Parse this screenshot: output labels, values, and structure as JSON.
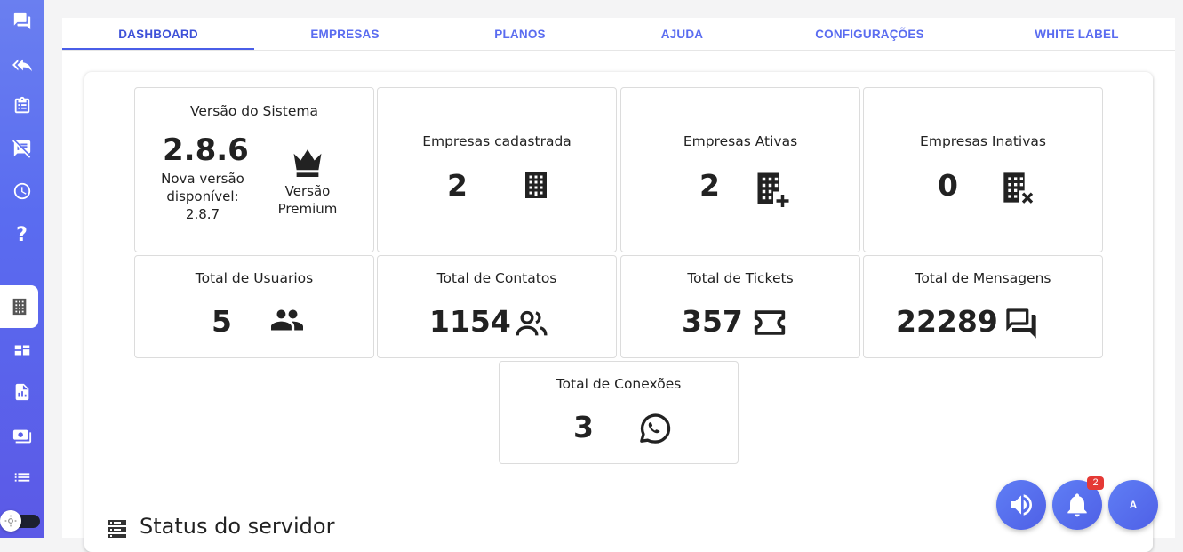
{
  "tabs": [
    {
      "label": "DASHBOARD",
      "active": true
    },
    {
      "label": "EMPRESAS"
    },
    {
      "label": "PLANOS"
    },
    {
      "label": "AJUDA"
    },
    {
      "label": "CONFIGURAÇÕES"
    },
    {
      "label": "WHITE LABEL"
    }
  ],
  "sidebar": {
    "items": [
      "chat-icon",
      "reply-all-icon",
      "clipboard-icon",
      "speaker-notes-off-icon",
      "clock-icon",
      "help-icon",
      "business-icon",
      "dashboard-icon",
      "report-icon",
      "payments-icon",
      "list-icon"
    ],
    "help_label": "?"
  },
  "cards": {
    "version": {
      "title": "Versão do Sistema",
      "value": "2.8.6",
      "note": "Nova versão disponível: 2.8.7",
      "premium": "Versão Premium"
    },
    "empresas_cadastradas": {
      "title": "Empresas cadastrada",
      "value": "2"
    },
    "empresas_ativas": {
      "title": "Empresas Ativas",
      "value": "2"
    },
    "empresas_inativas": {
      "title": "Empresas Inativas",
      "value": "0"
    },
    "usuarios": {
      "title": "Total de Usuarios",
      "value": "5"
    },
    "contatos": {
      "title": "Total de Contatos",
      "value": "1154"
    },
    "tickets": {
      "title": "Total de Tickets",
      "value": "357"
    },
    "mensagens": {
      "title": "Total de Mensagens",
      "value": "22289"
    },
    "conexoes": {
      "title": "Total de Conexões",
      "value": "3"
    }
  },
  "status": {
    "title": "Status do servidor"
  },
  "fabs": {
    "notification_count": "2",
    "avatar_letter": "A"
  },
  "colors": {
    "accent": "#5a6cf0",
    "badge": "#e53935"
  }
}
